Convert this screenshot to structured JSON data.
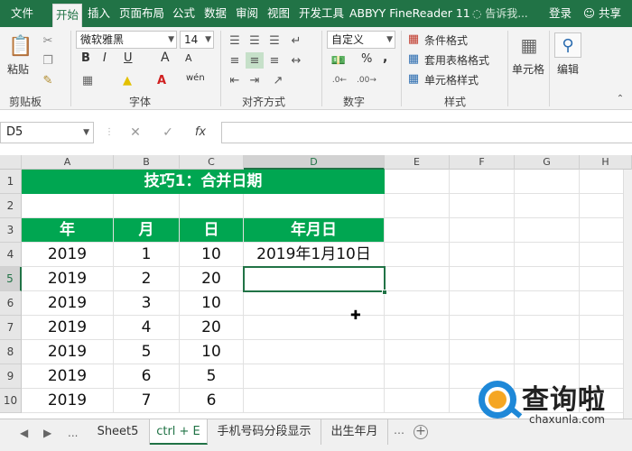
{
  "tabs": [
    "文件",
    "开始",
    "插入",
    "页面布局",
    "公式",
    "数据",
    "审阅",
    "视图",
    "开发工具",
    "ABBYY FineReader 11"
  ],
  "tell_me": "告诉我...",
  "login": "登录",
  "share": "共享",
  "ribbon": {
    "clipboard": {
      "label": "剪贴板",
      "paste": "粘贴"
    },
    "font": {
      "label": "字体",
      "name": "微软雅黑",
      "size": "14",
      "grow": "A",
      "shrink": "A",
      "bold": "B",
      "italic": "I",
      "underline": "U",
      "wen": "wén"
    },
    "alignment": {
      "label": "对齐方式"
    },
    "number": {
      "label": "数字",
      "format": "自定义",
      "percent": "%",
      "comma": ","
    },
    "styles": {
      "label": "样式",
      "conditional": "条件格式",
      "table_format": "套用表格格式",
      "cell_styles": "单元格样式"
    },
    "cells": {
      "label": "单元格"
    },
    "editing": {
      "label": "编辑"
    }
  },
  "formula_bar": {
    "name_box": "D5",
    "fx": "fx",
    "value": ""
  },
  "columns": [
    "A",
    "B",
    "C",
    "D",
    "E",
    "F",
    "G",
    "H"
  ],
  "rows": [
    "1",
    "2",
    "3",
    "4",
    "5",
    "6",
    "7",
    "8",
    "9",
    "10"
  ],
  "sheet": {
    "title": "技巧1：合并日期",
    "headers": [
      "年",
      "月",
      "日",
      "年月日"
    ],
    "data": [
      [
        "2019",
        "1",
        "10",
        "2019年1月10日"
      ],
      [
        "2019",
        "2",
        "20",
        ""
      ],
      [
        "2019",
        "3",
        "10",
        ""
      ],
      [
        "2019",
        "4",
        "20",
        ""
      ],
      [
        "2019",
        "5",
        "10",
        ""
      ],
      [
        "2019",
        "6",
        "5",
        ""
      ],
      [
        "2019",
        "7",
        "6",
        ""
      ]
    ]
  },
  "sheet_tabs": [
    "...",
    "Sheet5",
    "ctrl + E",
    "手机号码分段显示",
    "出生年月"
  ],
  "active_sheet_tab": "ctrl + E",
  "watermark": {
    "title": "查询啦",
    "url": "chaxunla.com"
  },
  "colors": {
    "excel_green": "#217346",
    "header_fill": "#00a651",
    "watermark_blue": "#1e88d8",
    "watermark_orange": "#f5a623"
  }
}
